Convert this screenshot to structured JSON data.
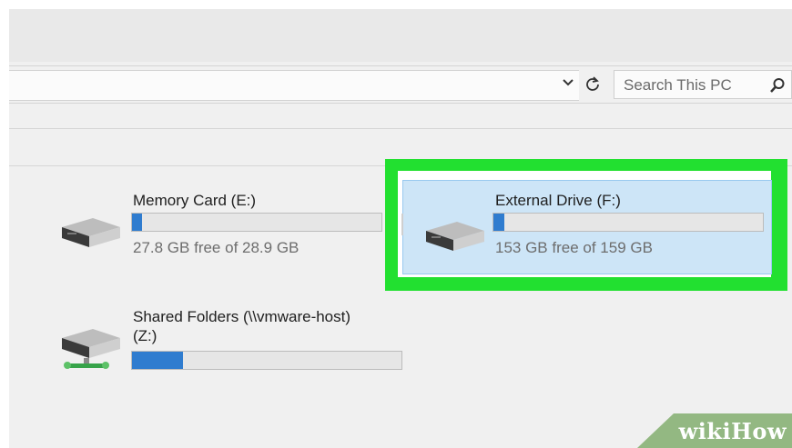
{
  "toolbar": {
    "search_placeholder": "Search This PC",
    "chevron_icon": "chevron-down-icon",
    "refresh_icon": "refresh-icon",
    "search_icon": "search-icon"
  },
  "drives": [
    {
      "name": "Memory Card (E:)",
      "free_text": "27.8 GB free of 28.9 GB",
      "used_fraction": 0.04,
      "icon": "removable-drive-icon"
    },
    {
      "name": "External Drive (F:)",
      "free_text": "153 GB free of 159 GB",
      "used_fraction": 0.04,
      "icon": "external-drive-icon",
      "selected": true
    },
    {
      "name_line1": "Shared Folders (\\\\vmware-host)",
      "name_line2": "(Z:)",
      "used_fraction": 0.19,
      "icon": "network-drive-icon"
    }
  ],
  "colors": {
    "highlight": "#22e030",
    "selection": "#cde5f7",
    "bar_fill": "#2f7ccf"
  },
  "watermark": "wikiHow"
}
